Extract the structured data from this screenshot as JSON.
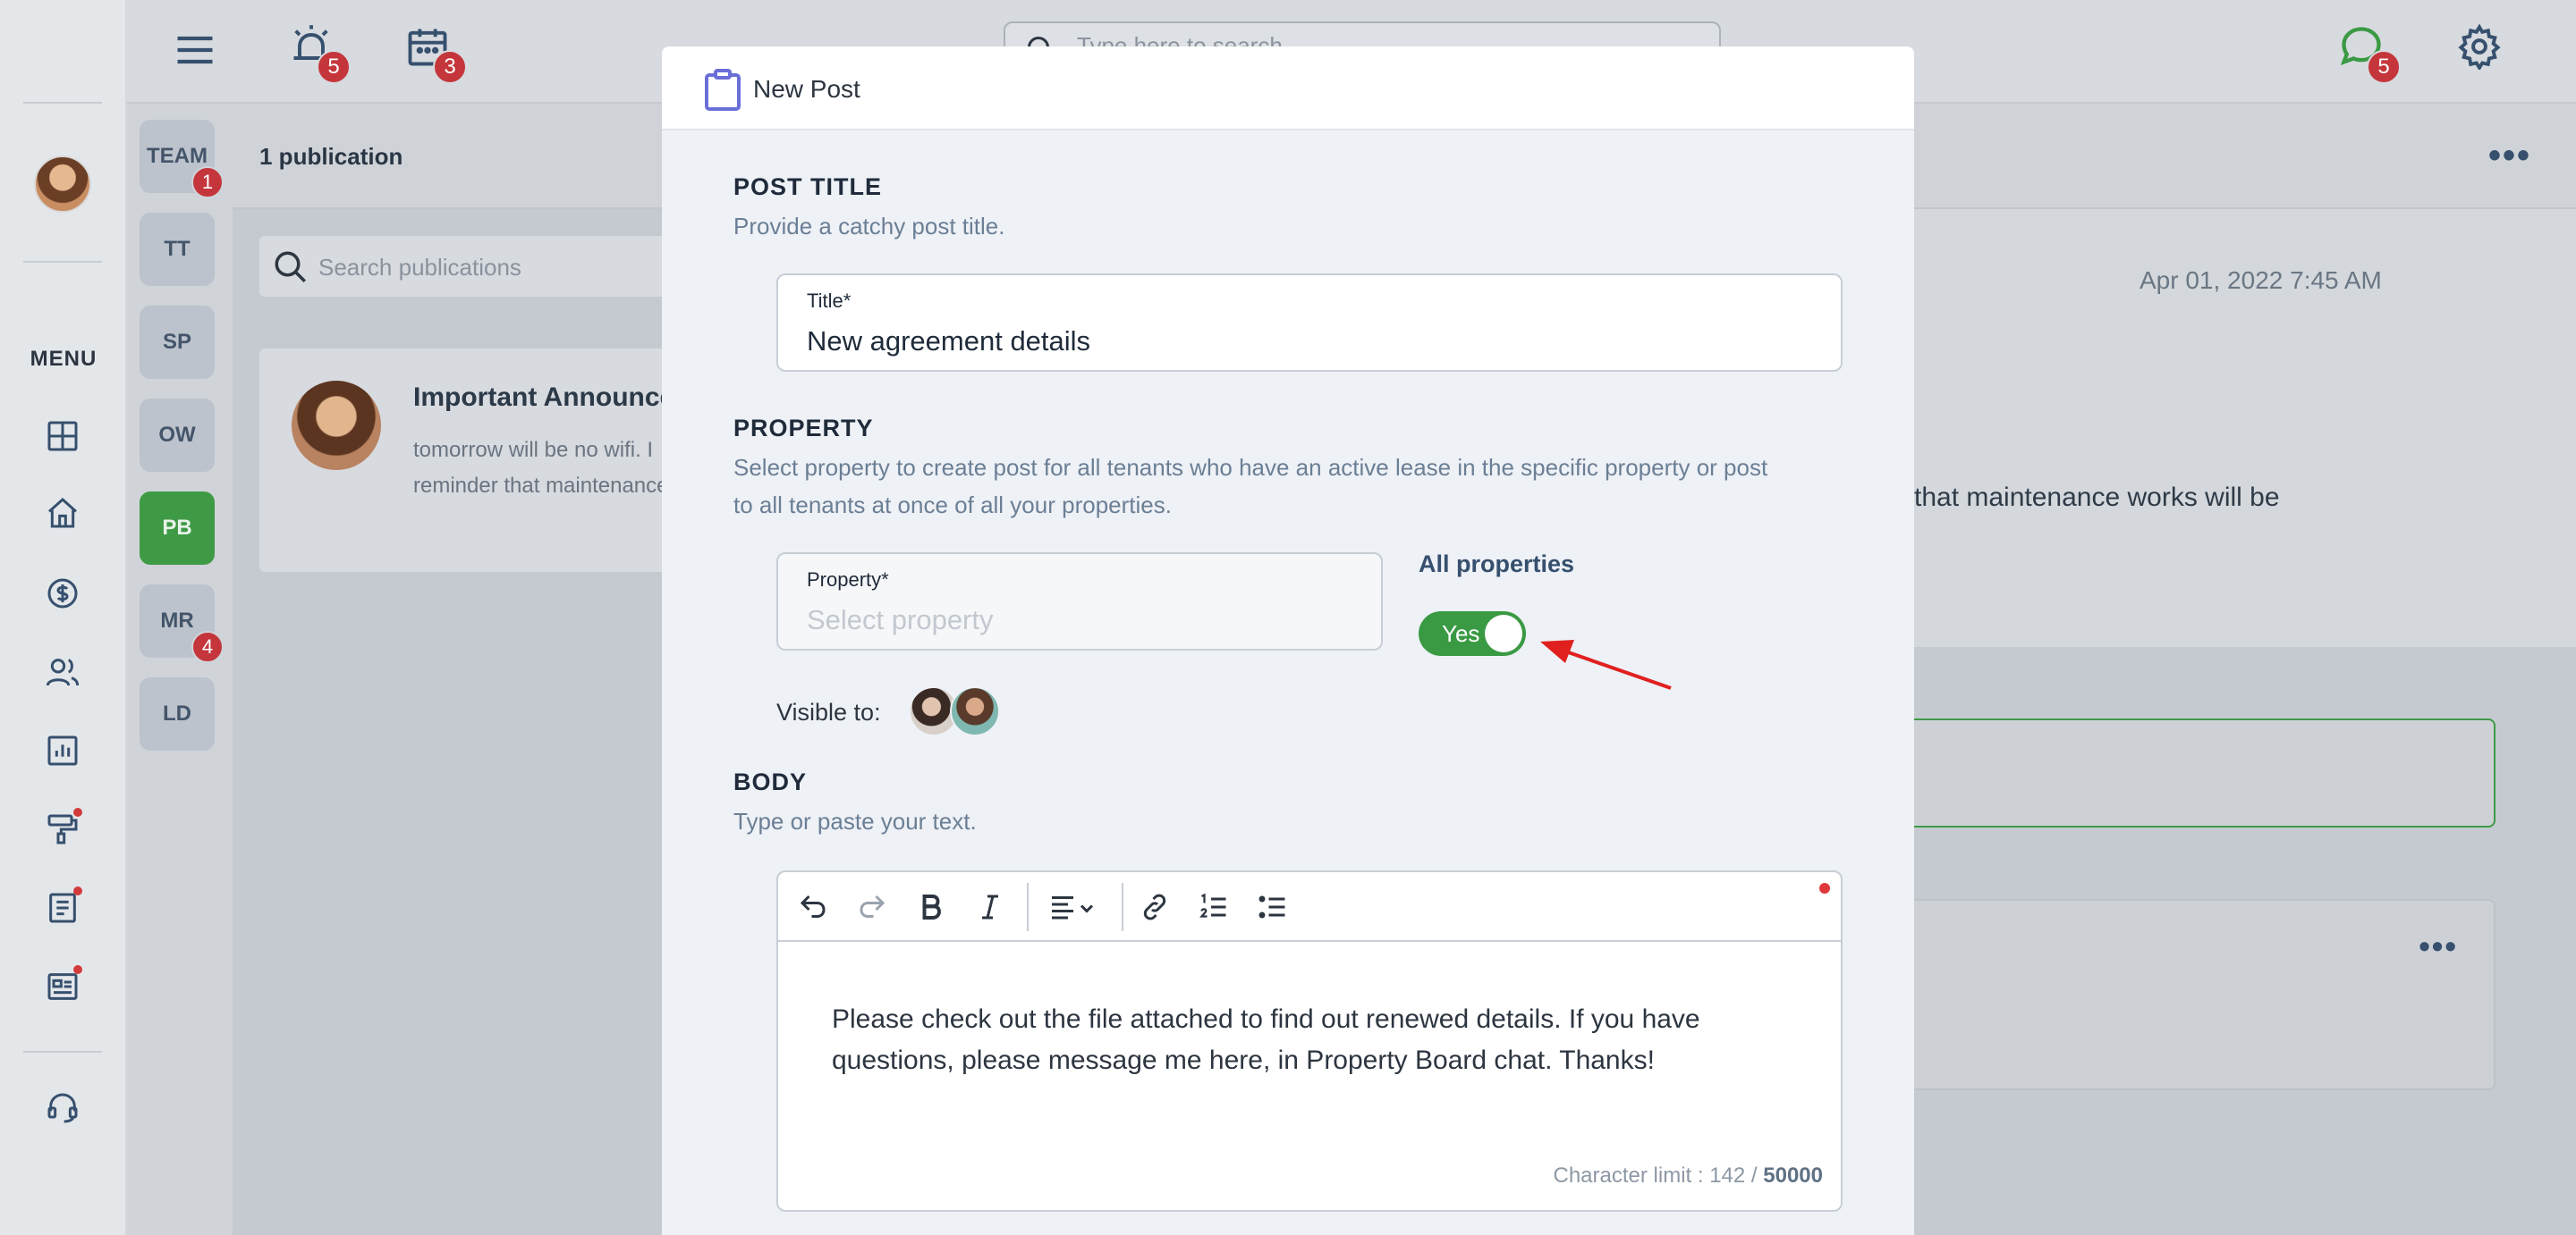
{
  "topbar": {
    "search_placeholder": "Type here to search",
    "alerts_badge": "5",
    "calendar_badge": "3",
    "chat_badge": "5"
  },
  "rail": {
    "menu_label": "MENU"
  },
  "groups": [
    {
      "label": "TEAM",
      "badge": "1",
      "active": false
    },
    {
      "label": "TT",
      "badge": "",
      "active": false
    },
    {
      "label": "SP",
      "badge": "",
      "active": false
    },
    {
      "label": "OW",
      "badge": "",
      "active": false
    },
    {
      "label": "PB",
      "badge": "",
      "active": true
    },
    {
      "label": "MR",
      "badge": "4",
      "active": false
    },
    {
      "label": "LD",
      "badge": "",
      "active": false
    }
  ],
  "publications": {
    "count_label": "1 publication",
    "search_placeholder": "Search publications",
    "card": {
      "title": "Important Announcement",
      "preview_line1": "tomorrow will be no wifi. I",
      "preview_line2": "reminder that maintenance"
    }
  },
  "detail": {
    "menu": "•••",
    "date": "Apr 01, 2022 7:45 AM",
    "text": "that maintenance works will be",
    "card_menu": "•••"
  },
  "modal": {
    "title": "New Post",
    "post_title": {
      "heading": "POST TITLE",
      "subtitle": "Provide a catchy post title.",
      "field_label": "Title*",
      "field_value": "New agreement details"
    },
    "property": {
      "heading": "PROPERTY",
      "subtitle_line1": "Select property to create post for all tenants who have an active lease in the specific property or post",
      "subtitle_line2": "to all tenants at once of all your properties.",
      "field_label": "Property*",
      "field_placeholder": "Select property",
      "all_properties_label": "All properties",
      "toggle_text": "Yes",
      "visible_to_label": "Visible to:"
    },
    "body": {
      "heading": "BODY",
      "subtitle": "Type or paste your text.",
      "text": "Please check out the file attached to find out renewed details. If you have questions, please message me here, in Property Board chat. Thanks!",
      "char_limit_label": "Character limit : 142 / ",
      "char_limit_max": "50000"
    }
  },
  "colors": {
    "accent_green": "#3a9a43",
    "badge_red": "#c4363b",
    "arrow_red": "#e0201f"
  }
}
